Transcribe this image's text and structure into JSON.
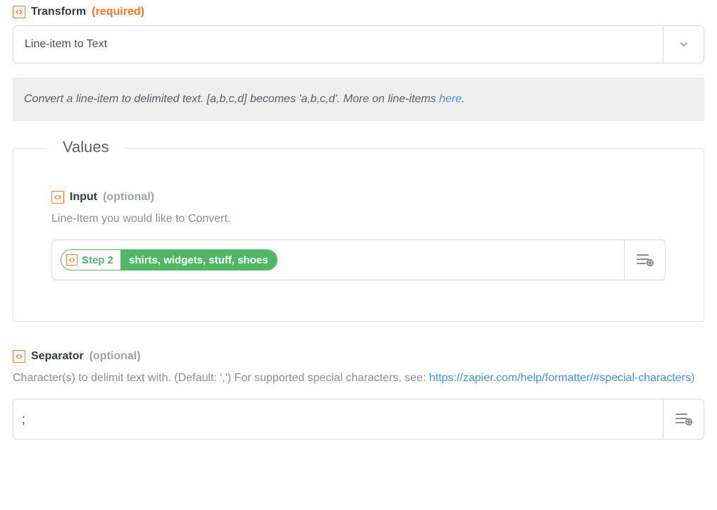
{
  "transform": {
    "label": "Transform",
    "required_tag": "(required)",
    "value": "Line-item to Text",
    "help_prefix": "Convert a line-item to delimited text. [a,b,c,d] becomes 'a,b,c,d'. More on line-items ",
    "help_link_text": "here",
    "help_suffix": "."
  },
  "values": {
    "legend": "Values",
    "input": {
      "label": "Input",
      "optional_tag": "(optional)",
      "help": "Line-Item you would like to Convert.",
      "pill_step": "Step 2",
      "pill_value": "shirts, widgets, stuff, shoes"
    }
  },
  "separator": {
    "label": "Separator",
    "optional_tag": "(optional)",
    "help_prefix": "Character(s) to delimit text with. (Default: ',') For supported special characters, see: ",
    "help_link_text": "https://zapier.com/help/formatter/#special-characters",
    "help_suffix": ")",
    "value": ";"
  }
}
